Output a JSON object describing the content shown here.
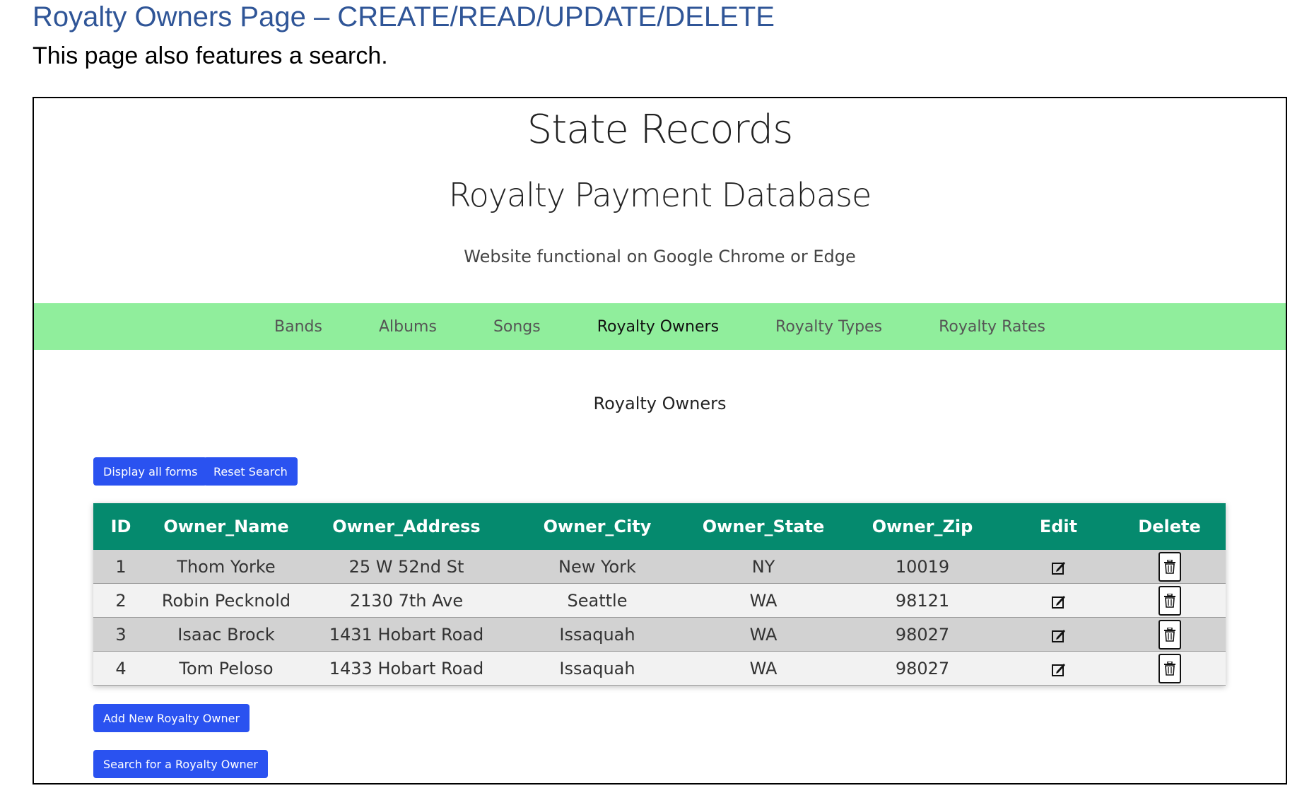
{
  "doc": {
    "title": "Royalty Owners Page – CREATE/READ/UPDATE/DELETE",
    "subtitle": "This page also features a search."
  },
  "site": {
    "title": "State Records",
    "subtitle": "Royalty Payment Database",
    "note": "Website functional on Google Chrome or Edge"
  },
  "nav": {
    "items": [
      {
        "label": "Bands",
        "active": false
      },
      {
        "label": "Albums",
        "active": false
      },
      {
        "label": "Songs",
        "active": false
      },
      {
        "label": "Royalty Owners",
        "active": true
      },
      {
        "label": "Royalty Types",
        "active": false
      },
      {
        "label": "Royalty Rates",
        "active": false
      }
    ]
  },
  "main": {
    "heading": "Royalty Owners",
    "display_all_label": "Display all forms",
    "reset_search_label": "Reset Search",
    "add_new_label": "Add New Royalty Owner",
    "search_label": "Search for a Royalty Owner"
  },
  "table": {
    "columns": [
      "ID",
      "Owner_Name",
      "Owner_Address",
      "Owner_City",
      "Owner_State",
      "Owner_Zip",
      "Edit",
      "Delete"
    ],
    "rows": [
      {
        "id": "1",
        "name": "Thom Yorke",
        "address": "25 W 52nd St",
        "city": "New York",
        "state": "NY",
        "zip": "10019"
      },
      {
        "id": "2",
        "name": "Robin Pecknold",
        "address": "2130 7th Ave",
        "city": "Seattle",
        "state": "WA",
        "zip": "98121"
      },
      {
        "id": "3",
        "name": "Isaac Brock",
        "address": "1431 Hobart Road",
        "city": "Issaquah",
        "state": "WA",
        "zip": "98027"
      },
      {
        "id": "4",
        "name": "Tom Peloso",
        "address": "1433 Hobart Road",
        "city": "Issaquah",
        "state": "WA",
        "zip": "98027"
      }
    ]
  },
  "colors": {
    "nav_bg": "#90ee9c",
    "header_bg": "#058a6e",
    "button_bg": "#2a52f0",
    "doc_title": "#2f5597"
  },
  "icons": {
    "edit": "edit-icon",
    "delete": "trash-icon"
  }
}
